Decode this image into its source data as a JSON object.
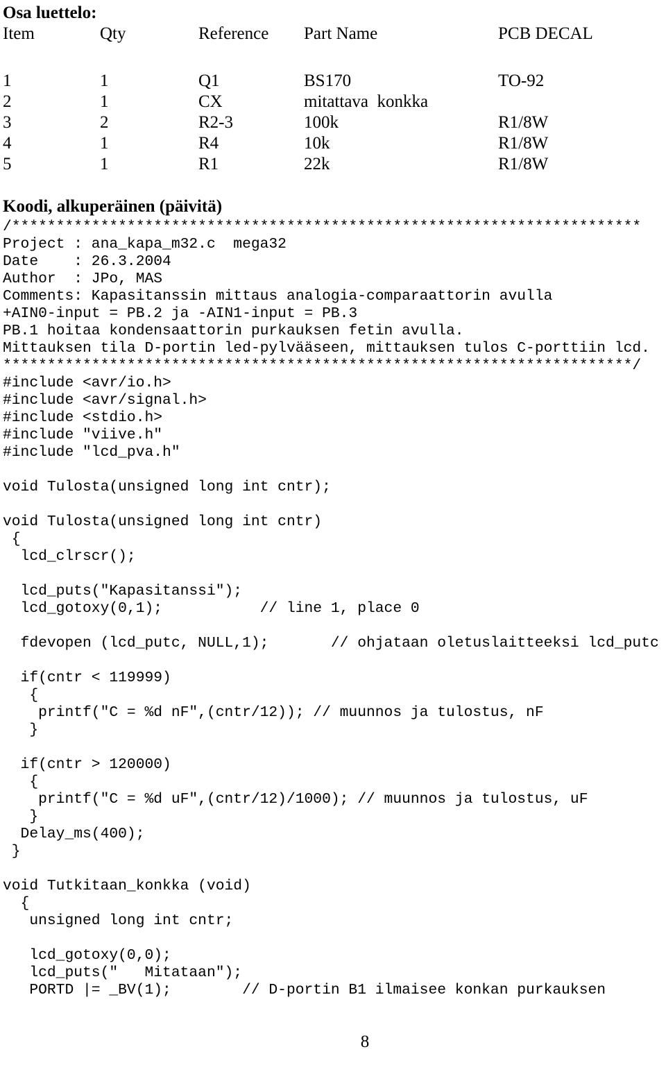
{
  "parts_section": {
    "title": "Osa luettelo:",
    "columns": [
      "Item",
      "Qty",
      "Reference",
      "Part Name",
      "PCB DECAL"
    ],
    "rows": [
      {
        "item": "1",
        "qty": "1",
        "reference": "Q1",
        "part_name": "BS170",
        "pcb_decal": "TO-92"
      },
      {
        "item": "2",
        "qty": "1",
        "reference": "CX",
        "part_name": "mitattava  konkka",
        "pcb_decal": ""
      },
      {
        "item": "3",
        "qty": "2",
        "reference": "R2-3",
        "part_name": "100k",
        "pcb_decal": "R1/8W"
      },
      {
        "item": "4",
        "qty": "1",
        "reference": "R4",
        "part_name": "10k",
        "pcb_decal": "R1/8W"
      },
      {
        "item": "5",
        "qty": "1",
        "reference": "R1",
        "part_name": "22k",
        "pcb_decal": "R1/8W"
      }
    ]
  },
  "code_section": {
    "heading": "Koodi, alkuperäinen (päivitä)",
    "lines": [
      "/***********************************************************************",
      "Project : ana_kapa_m32.c  mega32",
      "Date    : 26.3.2004",
      "Author  : JPo, MAS",
      "Comments: Kapasitanssin mittaus analogia-comparaattorin avulla",
      "+AIN0-input = PB.2 ja -AIN1-input = PB.3",
      "PB.1 hoitaa kondensaattorin purkauksen fetin avulla.",
      "Mittauksen tila D-portin led-pylvääseen, mittauksen tulos C-porttiin lcd.",
      "***********************************************************************/",
      "#include <avr/io.h>",
      "#include <avr/signal.h>",
      "#include <stdio.h>",
      "#include \"viive.h\"",
      "#include \"lcd_pva.h\"",
      "",
      "void Tulosta(unsigned long int cntr);",
      "",
      "void Tulosta(unsigned long int cntr)",
      " {",
      "  lcd_clrscr();",
      "",
      "  lcd_puts(\"Kapasitanssi\");",
      "  lcd_gotoxy(0,1);           // line 1, place 0",
      "",
      "  fdevopen (lcd_putc, NULL,1);       // ohjataan oletuslaitteeksi lcd_putc",
      "",
      "  if(cntr < 119999)",
      "   {",
      "    printf(\"C = %d nF\",(cntr/12)); // muunnos ja tulostus, nF",
      "   }",
      "",
      "  if(cntr > 120000)",
      "   {",
      "    printf(\"C = %d uF\",(cntr/12)/1000); // muunnos ja tulostus, uF",
      "   }",
      "  Delay_ms(400);",
      " }",
      "",
      "void Tutkitaan_konkka (void)",
      "  {",
      "   unsigned long int cntr;",
      "",
      "   lcd_gotoxy(0,0);",
      "   lcd_puts(\"   Mitataan\");",
      "   PORTD |= _BV(1);        // D-portin B1 ilmaisee konkan purkauksen"
    ]
  },
  "footer": {
    "page_number": "8"
  },
  "colors": {
    "text": "#000000",
    "background": "#ffffff"
  }
}
